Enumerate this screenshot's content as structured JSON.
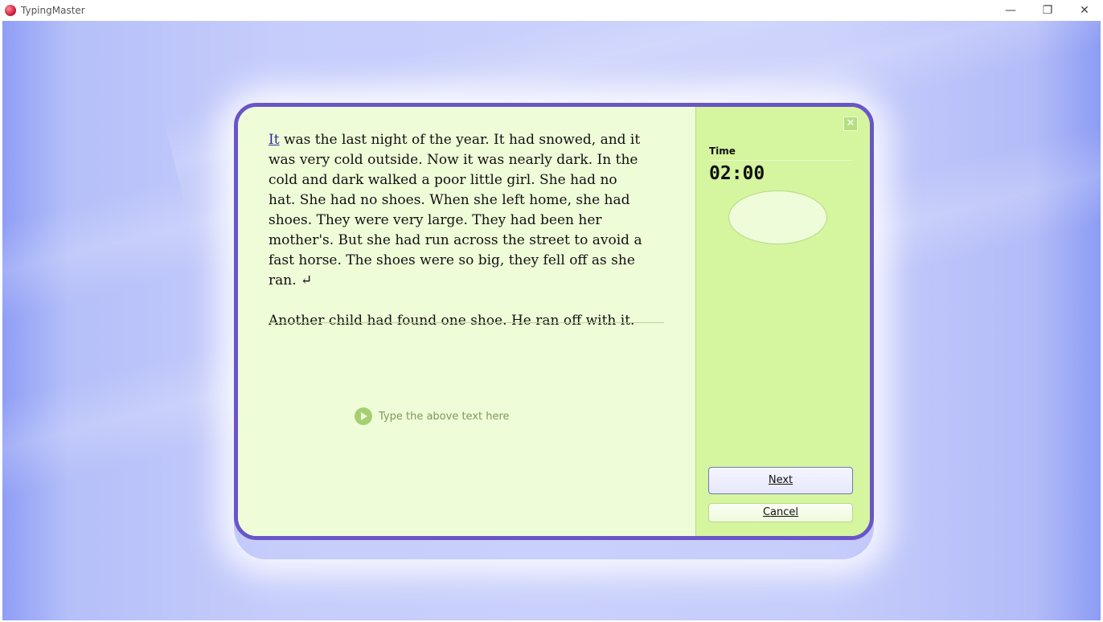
{
  "window": {
    "title": "TypingMaster",
    "minimize_glyph": "—",
    "restore_glyph": "❐",
    "close_glyph": "✕"
  },
  "passage": {
    "current_word": "It",
    "paragraph1_rest": " was the last night of the year. It had snowed, and it was very cold outside. Now it was nearly dark. In the cold and dark walked a poor little girl. She had no hat. She had no shoes. When she left home, she had shoes. They were very large. They had been her mother's. But she had run across the street to avoid a fast horse. The shoes were so big, they fell off as she ran.",
    "enter_glyph": " ↵",
    "paragraph2": "Another child had found one shoe. He ran off with it."
  },
  "input_hint": "Type the above text here",
  "side_panel": {
    "close_glyph": "✕",
    "time_label": "Time",
    "time_value": "02:00",
    "next_label": "Next",
    "cancel_label": "Cancel"
  },
  "icons": {
    "app": "typingmaster-logo-icon",
    "play": "play-icon",
    "close": "close-icon"
  }
}
